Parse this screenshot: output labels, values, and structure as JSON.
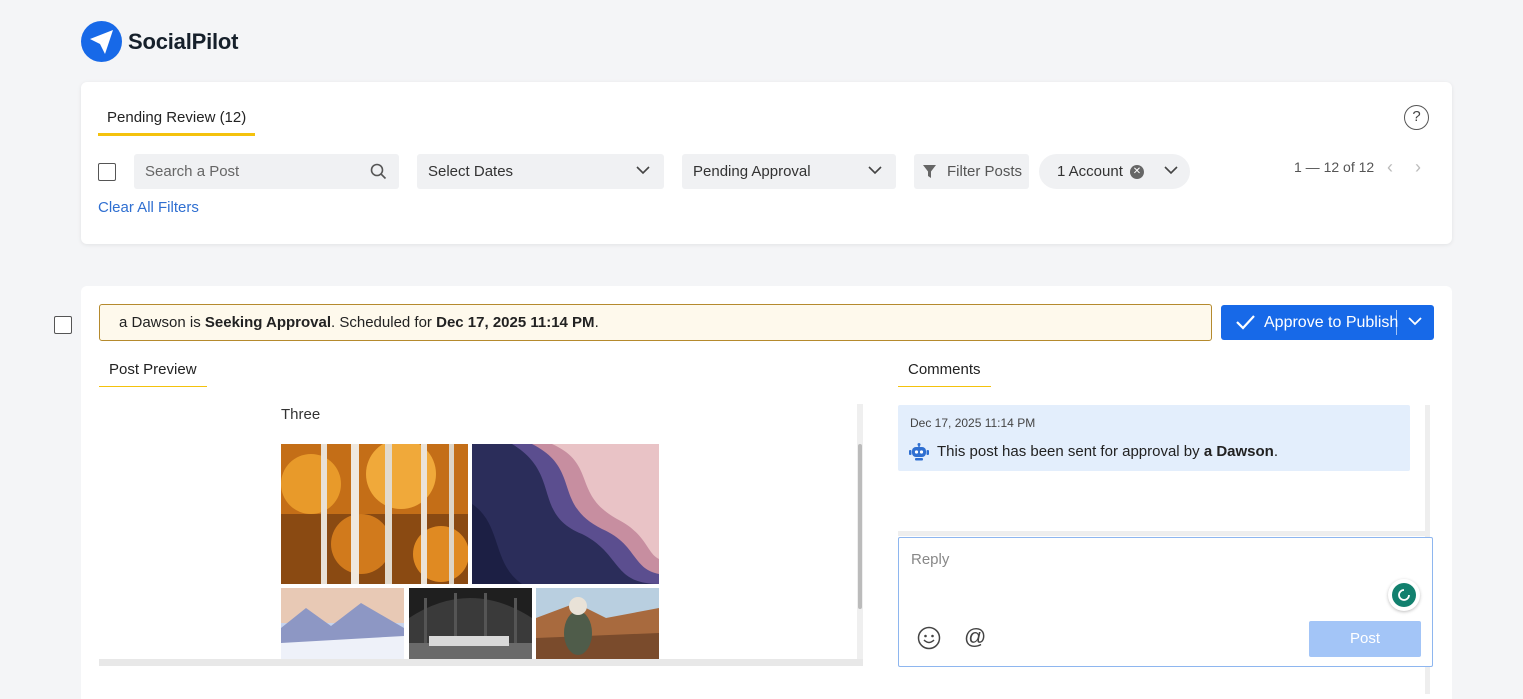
{
  "app": {
    "logo_text": "SocialPilot"
  },
  "header": {
    "tab_label": "Pending Review (12)",
    "help_label": "?"
  },
  "filters": {
    "search_placeholder": "Search a Post",
    "dates_label": "Select Dates",
    "status_label": "Pending Approval",
    "filter_posts_label": "Filter Posts",
    "account_label": "1 Account",
    "clear_all_label": "Clear All Filters",
    "pagination_text": "1 — 12 of 12"
  },
  "post": {
    "author": "a Dawson",
    "status_prefix": " is ",
    "status_word": "Seeking Approval",
    "scheduled_prefix": ". Scheduled for ",
    "scheduled_date": "Dec 17, 2025  11:14 PM",
    "approve_label": "Approve to Publish",
    "preview_tab": "Post Preview",
    "comments_tab": "Comments",
    "caption": "Three",
    "images": [
      "autumn-aspen-forest",
      "slot-canyon",
      "snowy-mountains",
      "train-station",
      "desert-hiker"
    ]
  },
  "comments": [
    {
      "time": "Dec 17, 2025  11:14 PM",
      "text_prefix": "This post has been sent for approval by ",
      "author": "a Dawson",
      "text_suffix": "."
    }
  ],
  "reply": {
    "placeholder": "Reply",
    "post_label": "Post"
  },
  "colors": {
    "primary": "#1769e8",
    "tab_underline": "#f4c20d",
    "banner_bg": "#fef9ec",
    "comment_bg": "#e3eefc"
  }
}
